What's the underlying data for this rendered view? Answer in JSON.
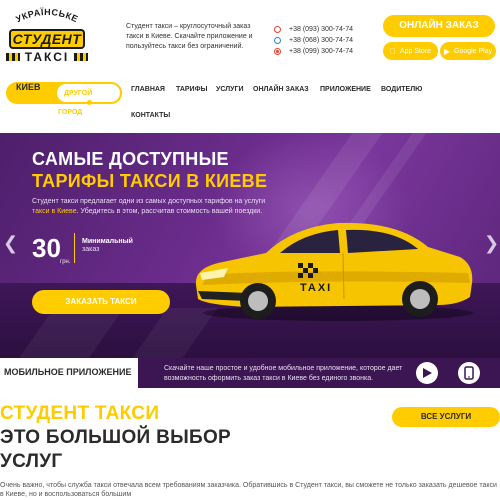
{
  "header": {
    "logo": {
      "arc_text": "УКРАЇНСЬКЕ",
      "main_text": "СТУДЕНТ",
      "sub_text": "ТАКСІ"
    },
    "intro": "Студент такси – круглосуточный заказ такси в Киеве. Скачайте приложение и пользуйтесь такси без ограничений.",
    "phones": [
      {
        "icon": "vodafone-icon",
        "number": "+38 (093) 300-74-74"
      },
      {
        "icon": "kyivstar-icon",
        "number": "+38 (068) 300-74-74"
      },
      {
        "icon": "lifecell-icon",
        "number": "+38 (099) 300-74-74"
      }
    ],
    "order_online_label": "Онлайн заказ",
    "app_store_label": "App Store",
    "google_play_label": "Google Play"
  },
  "nav": {
    "city_current": "КИЕВ",
    "city_other_line1": "Другой",
    "city_other_line2": "город",
    "links": [
      "ГЛАВНАЯ",
      "ТАРИФЫ",
      "УСЛУГИ",
      "ОНЛАЙН ЗАКАЗ",
      "ПРИЛОЖЕНИЕ",
      "ВОДИТЕЛЮ",
      "КОНТАКТЫ"
    ]
  },
  "hero": {
    "title_line1": "САМЫЕ ДОСТУПНЫЕ",
    "title_line2": "ТАРИФЫ ТАКСИ В КИЕВЕ",
    "desc_part1": "Студент такси предлагает одни из самых доступных тарифов на услуги ",
    "desc_highlight": "такси в Киеве",
    "desc_part2": ". Убедитесь в этом, рассчитав стоимость вашей поездки.",
    "price_value": "30",
    "price_unit": "грн.",
    "price_label_line1": "Минимальный",
    "price_label_line2": "заказ",
    "order_button_label": "ЗАКАЗАТЬ ТАКСИ",
    "car_sign": "TAXI",
    "colors": {
      "accent": "#ffcc00",
      "purple": "#6a2c8b"
    }
  },
  "app_band": {
    "title": "МОБИЛЬНОЕ ПРИЛОЖЕНИЕ",
    "text": "Скачайте наше простое и удобное мобильное приложение, которое дает возможность оформить заказ такси в Киеве без единого звонка."
  },
  "services": {
    "title_line1": "СТУДЕНТ ТАКСИ",
    "title_line2": "ЭТО БОЛЬШОЙ ВЫБОР",
    "title_line3": "УСЛУГ",
    "all_services_label": "ВСЕ УСЛУГИ",
    "description": "Очень важно, чтобы служба такси отвечала всем требованиям заказчика. Обратившись в Студент такси, вы сможете не только заказать дешевое такси в Киеве, но и воспользоваться большим"
  }
}
